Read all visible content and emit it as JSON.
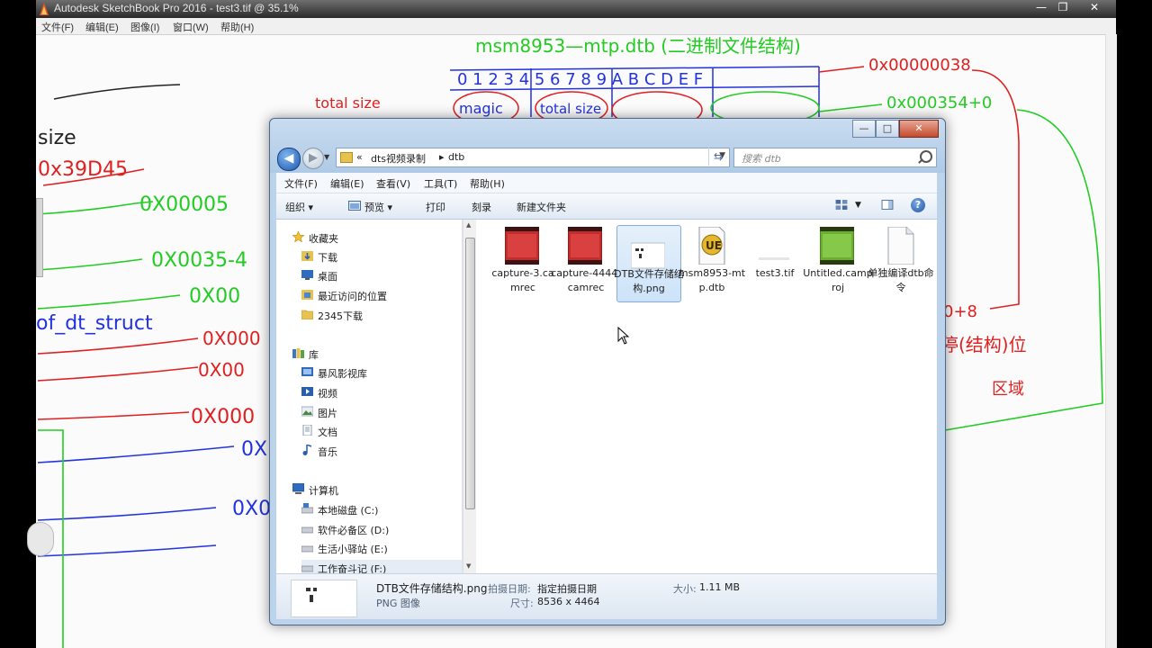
{
  "app": {
    "title": "Autodesk SketchBook Pro 2016 - test3.tif @ 35.1%",
    "menus": [
      "文件(F)",
      "编辑(E)",
      "图像(I)",
      "窗口(W)",
      "帮助(H)"
    ],
    "window_controls": [
      "—",
      "❐",
      "✕"
    ]
  },
  "explorer": {
    "window_controls": [
      "—",
      "□",
      "✕"
    ],
    "breadcrumb": [
      "«",
      "dts视频录制",
      "▸",
      "dtb"
    ],
    "search_placeholder": "搜索 dtb",
    "menus": [
      "文件(F)",
      "编辑(E)",
      "查看(V)",
      "工具(T)",
      "帮助(H)"
    ],
    "toolbar": {
      "organize": "组织 ▾",
      "preview": "预览 ▾",
      "print": "打印",
      "burn": "刻录",
      "new_folder": "新建文件夹",
      "help": "?"
    },
    "nav": {
      "favorites": {
        "label": "收藏夹",
        "items": [
          "下载",
          "桌面",
          "最近访问的位置",
          "2345下载"
        ]
      },
      "library": {
        "label": "库",
        "items": [
          "暴风影视库",
          "视频",
          "图片",
          "文档",
          "音乐"
        ]
      },
      "computer": {
        "label": "计算机",
        "items": [
          "本地磁盘 (C:)",
          "软件必备区 (D:)",
          "生活小驿站 (E:)",
          "工作奋斗记 (F:)"
        ]
      }
    },
    "files": [
      {
        "name": "capture-3.camrec",
        "icon": "video-file-icon",
        "selected": false
      },
      {
        "name": "capture-4444.camrec",
        "icon": "video-file-icon",
        "selected": false
      },
      {
        "name": "DTB文件存储结构.png",
        "icon": "image-file-icon",
        "selected": true
      },
      {
        "name": "msm8953-mtp.dtb",
        "icon": "ultraedit-file-icon",
        "selected": false
      },
      {
        "name": "test3.tif",
        "icon": "tif-file-icon",
        "selected": false
      },
      {
        "name": "Untitled.camproj",
        "icon": "camproj-file-icon",
        "selected": false
      },
      {
        "name": "单独编译dtb命令",
        "icon": "blank-file-icon",
        "selected": false
      }
    ],
    "details": {
      "filename": "DTB文件存储结构.png",
      "type": "PNG 图像",
      "date_label": "拍摄日期:",
      "date_value": "指定拍摄日期",
      "size_label": "大小:",
      "size_value": "1.11 MB",
      "dims_label": "尺寸:",
      "dims_value": "8536 x 4464"
    }
  },
  "canvas_sketch": {
    "texts": [
      "msm8953—mtp.dtb (二进制文件结构)",
      "0x00000038",
      "0x000354+0",
      "0x39D45",
      "total size",
      "of_dt_struct",
      "size"
    ],
    "colors": {
      "green": "#22cc22",
      "red": "#e02020",
      "blue": "#2233dd",
      "black": "#222222"
    }
  }
}
